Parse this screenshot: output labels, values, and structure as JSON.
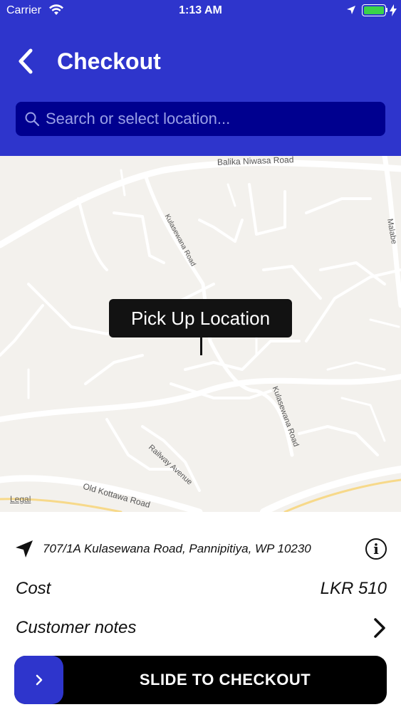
{
  "status_bar": {
    "carrier": "Carrier",
    "time": "1:13 AM",
    "battery_color": "#3ad24a"
  },
  "header": {
    "title": "Checkout",
    "back_icon": "chevron-left-icon",
    "background": "#2e35cc"
  },
  "search": {
    "placeholder": "Search or select location...",
    "value": "",
    "icon": "search-icon"
  },
  "map": {
    "pin_label": "Pick Up Location",
    "legal": "Legal",
    "road_labels": {
      "balika_niwasa": "Balika Niwasa Road",
      "kulasewana_1": "Kulasewana Road",
      "kulasewana_2": "Kulasewana Road",
      "railway_avenue": "Railway Avenue",
      "old_kottawa": "Old Kottawa Road",
      "malabe": "Malabe"
    }
  },
  "details": {
    "address": "707/1A Kulasewana Road, Pannipitiya, WP 10230",
    "address_icon": "navigation-arrow-icon",
    "info_icon": "info-icon",
    "cost_label": "Cost",
    "cost_value": "LKR 510",
    "notes_label": "Customer notes",
    "notes_icon": "chevron-right-icon"
  },
  "slide": {
    "label": "SLIDE TO CHECKOUT",
    "handle_symbol": "›",
    "accent": "#2e35cc"
  }
}
